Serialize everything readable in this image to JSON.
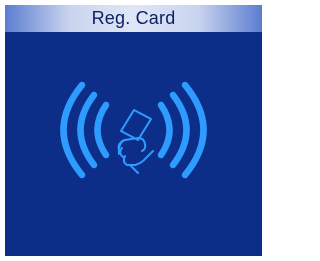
{
  "window": {
    "title": "Reg. Card"
  },
  "graphic": {
    "icon": "nfc-card-tap-icon"
  },
  "colors": {
    "background": "#0c2e88",
    "icon": "#2e9bff",
    "title_text": "#0b1f63"
  }
}
